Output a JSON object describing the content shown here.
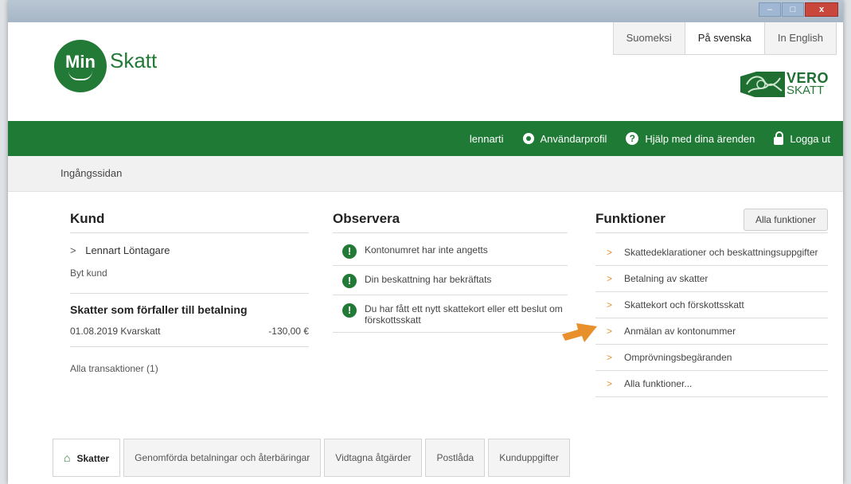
{
  "languages": [
    {
      "label": "Suomeksi",
      "active": false
    },
    {
      "label": "På svenska",
      "active": true
    },
    {
      "label": "In English",
      "active": false
    }
  ],
  "logo": {
    "circle": "Min",
    "word": "Skatt"
  },
  "vero": {
    "line1": "VERO",
    "line2": "SKATT"
  },
  "nav": {
    "user": "lennarti",
    "profile": "Användarprofil",
    "help": "Hjälp med dina ärenden",
    "logout": "Logga ut"
  },
  "breadcrumb": "Ingångssidan",
  "kund": {
    "title": "Kund",
    "person": "Lennart Löntagare",
    "change_customer": "Byt kund",
    "taxes_title": "Skatter som förfaller till betalning",
    "tax_row": {
      "date_desc": "01.08.2019 Kvarskatt",
      "amount": "-130,00 €"
    },
    "all_transactions": "Alla transaktioner (1)"
  },
  "observera": {
    "title": "Observera",
    "notes": [
      "Kontonumret har inte angetts",
      "Din beskattning har bekräftats",
      "Du har fått ett nytt skattekort eller ett beslut om förskottsskatt"
    ]
  },
  "funktioner": {
    "title": "Funktioner",
    "all_button": "Alla funktioner",
    "items": [
      "Skattedeklarationer och beskattningsuppgifter",
      "Betalning av skatter",
      "Skattekort och förskottsskatt",
      "Anmälan av kontonummer",
      "Omprövningsbegäranden",
      "Alla funktioner..."
    ]
  },
  "tabs": [
    {
      "label": "Skatter",
      "active": true
    },
    {
      "label": "Genomförda betalningar och återbäringar",
      "active": false
    },
    {
      "label": "Vidtagna åtgärder",
      "active": false
    },
    {
      "label": "Postlåda",
      "active": false
    },
    {
      "label": "Kunduppgifter",
      "active": false
    }
  ],
  "colors": {
    "brand_green": "#1f7a35",
    "arrow_orange": "#e8902c"
  }
}
